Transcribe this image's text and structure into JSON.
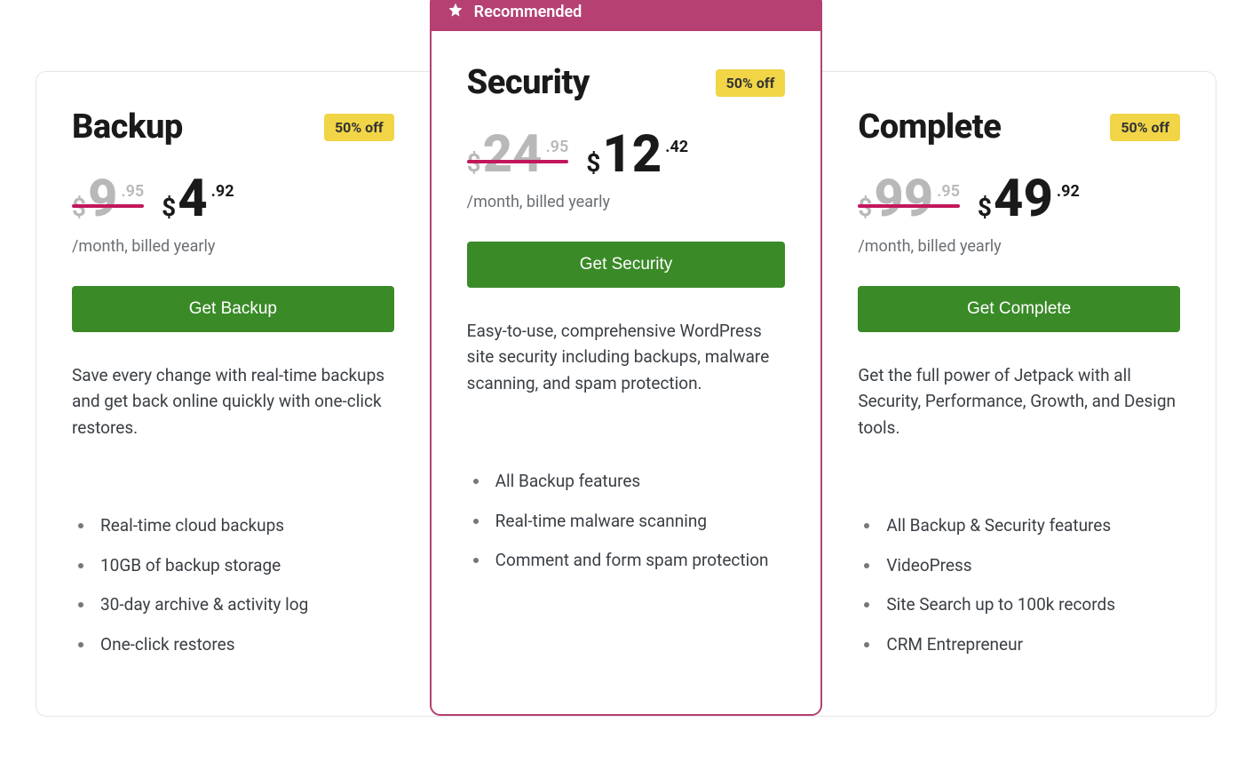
{
  "recommended_label": "Recommended",
  "billing_note": "/month, billed yearly",
  "plans": [
    {
      "key": "backup",
      "title": "Backup",
      "badge": "50% off",
      "old_currency": "$",
      "old_integer": "9",
      "old_cents": ".95",
      "new_currency": "$",
      "new_integer": "4",
      "new_cents": ".92",
      "cta": "Get Backup",
      "desc": "Save every change with real-time backups and get back online quickly with one-click restores.",
      "features": [
        "Real-time cloud backups",
        "10GB of backup storage",
        "30-day archive & activity log",
        "One-click restores"
      ],
      "recommended": false
    },
    {
      "key": "security",
      "title": "Security",
      "badge": "50% off",
      "old_currency": "$",
      "old_integer": "24",
      "old_cents": ".95",
      "new_currency": "$",
      "new_integer": "12",
      "new_cents": ".42",
      "cta": "Get Security",
      "desc": "Easy-to-use, comprehensive WordPress site security including backups, malware scanning, and spam protection.",
      "features": [
        "All Backup features",
        "Real-time malware scanning",
        "Comment and form spam protection"
      ],
      "recommended": true
    },
    {
      "key": "complete",
      "title": "Complete",
      "badge": "50% off",
      "old_currency": "$",
      "old_integer": "99",
      "old_cents": ".95",
      "new_currency": "$",
      "new_integer": "49",
      "new_cents": ".92",
      "cta": "Get Complete",
      "desc": "Get the full power of Jetpack with all Security, Performance, Growth, and Design tools.",
      "features": [
        "All Backup & Security features",
        "VideoPress",
        "Site Search up to 100k records",
        "CRM Entrepreneur"
      ],
      "recommended": false
    }
  ]
}
